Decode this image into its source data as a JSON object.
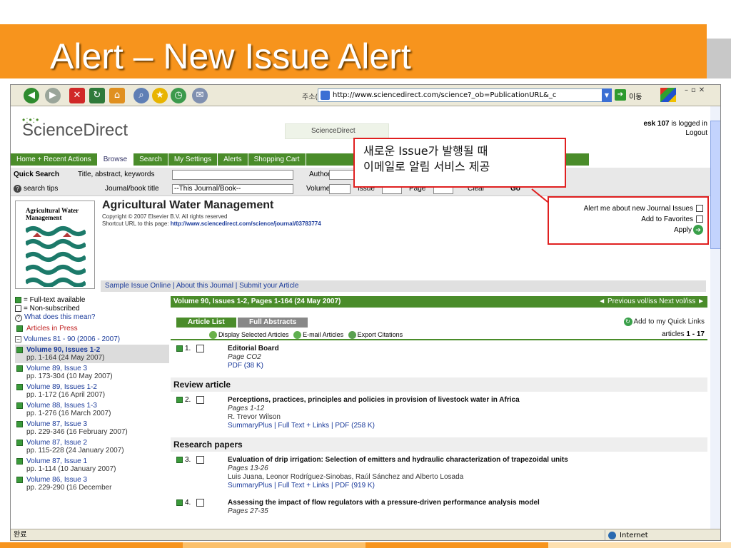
{
  "slide": {
    "title": "Alert – New Issue Alert"
  },
  "browser": {
    "address_label": "주소(D)",
    "url": "http://www.sciencedirect.com/science?_ob=PublicationURL&_c",
    "go_label": "이동",
    "status_text": "완료",
    "zone_text": "Internet"
  },
  "site": {
    "logo": "ScienceDirect",
    "mini_logo": "ScienceDirect",
    "user_name": "esk 107",
    "logged_in_text": "is logged in",
    "logout": "Logout"
  },
  "nav": [
    "Home + Recent Actions",
    "Browse",
    "Search",
    "My Settings",
    "Alerts",
    "Shopping Cart"
  ],
  "quick_search": {
    "label": "Quick Search",
    "title_label": "Title, abstract, keywords",
    "author_label": "Author",
    "search_tips": "search tips",
    "journal_label": "Journal/book title",
    "journal_value": "--This Journal/Book--",
    "volume_label": "Volume",
    "issue_label": "Issue",
    "page_label": "Page",
    "clear_label": "Clear",
    "go_label": "Go"
  },
  "callout": {
    "line1": "새로운 Issue가 발행될 때",
    "line2": "이메일로 알림 서비스 제공"
  },
  "alert_box": {
    "alert_label": "Alert me about new Journal Issues",
    "favorites_label": "Add to Favorites",
    "apply_label": "Apply"
  },
  "journal": {
    "cover_title": "Agricultural Water Management",
    "title": "Agricultural Water Management",
    "copyright": "Copyright © 2007 Elsevier B.V. All rights reserved",
    "short_url_label": "Shortcut URL to this page:",
    "short_url": "http://www.sciencedirect.com/science/journal/03783774",
    "links": "Sample Issue Online | About this Journal | Submit your Article"
  },
  "legend": {
    "full_text": "= Full-text available",
    "non_subscribed": "= Non-subscribed",
    "what": "What does this mean?"
  },
  "left_nav": {
    "articles_in_press": "Articles in Press",
    "volumes_group": "Volumes 81 - 90 (2006 - 2007)",
    "volumes": [
      {
        "name": "Volume 90, Issues 1-2",
        "pages": "pp. 1-164 (24 May 2007)"
      },
      {
        "name": "Volume 89, Issue 3",
        "pages": "pp. 173-304 (10 May 2007)"
      },
      {
        "name": "Volume 89, Issues 1-2",
        "pages": "pp. 1-172 (16 April 2007)"
      },
      {
        "name": "Volume 88, Issues 1-3",
        "pages": "pp. 1-276 (16 March 2007)"
      },
      {
        "name": "Volume 87, Issue 3",
        "pages": "pp. 229-346 (16 February 2007)"
      },
      {
        "name": "Volume 87, Issue 2",
        "pages": "pp. 115-228 (24 January 2007)"
      },
      {
        "name": "Volume 87, Issue 1",
        "pages": "pp. 1-114 (10 January 2007)"
      },
      {
        "name": "Volume 86, Issue 3",
        "pages": "pp. 229-290 (16 December"
      }
    ]
  },
  "volume_header": "Volume 90, Issues 1-2, Pages 1-164 (24 May 2007)",
  "vol_nav": "◄ Previous vol/iss   Next vol/iss ►",
  "tabs": {
    "article_list": "Article List",
    "full_abstracts": "Full Abstracts"
  },
  "quick_links": "Add to my Quick Links",
  "actions": {
    "display": "Display Selected Articles",
    "email": "E-mail Articles",
    "export": "Export Citations"
  },
  "articles_count": {
    "prefix": "articles",
    "range": "1 - 17"
  },
  "sections": {
    "review": "Review article",
    "research": "Research papers"
  },
  "articles": [
    {
      "num": "1.",
      "title": "Editorial Board",
      "pages": "Page CO2",
      "authors": "",
      "links": "PDF (38 K)"
    },
    {
      "num": "2.",
      "title": "Perceptions, practices, principles and policies in provision of livestock water in Africa",
      "pages": "Pages 1-12",
      "authors": "R. Trevor Wilson",
      "links": "SummaryPlus | Full Text + Links | PDF (258 K)"
    },
    {
      "num": "3.",
      "title": "Evaluation of drip irrigation: Selection of emitters and hydraulic characterization of trapezoidal units",
      "pages": "Pages 13-26",
      "authors": "Luis Juana, Leonor Rodríguez-Sinobas, Raúl Sánchez and Alberto Losada",
      "links": "SummaryPlus | Full Text + Links | PDF (919 K)"
    },
    {
      "num": "4.",
      "title": "Assessing the impact of flow regulators with a pressure-driven performance analysis model",
      "pages": "Pages 27-35",
      "authors": "",
      "links": ""
    }
  ],
  "colors": {
    "accent": "#f7941d",
    "sd_green": "#4a8c2a",
    "callout_red": "#e02020",
    "link_blue": "#1a3a9a"
  }
}
